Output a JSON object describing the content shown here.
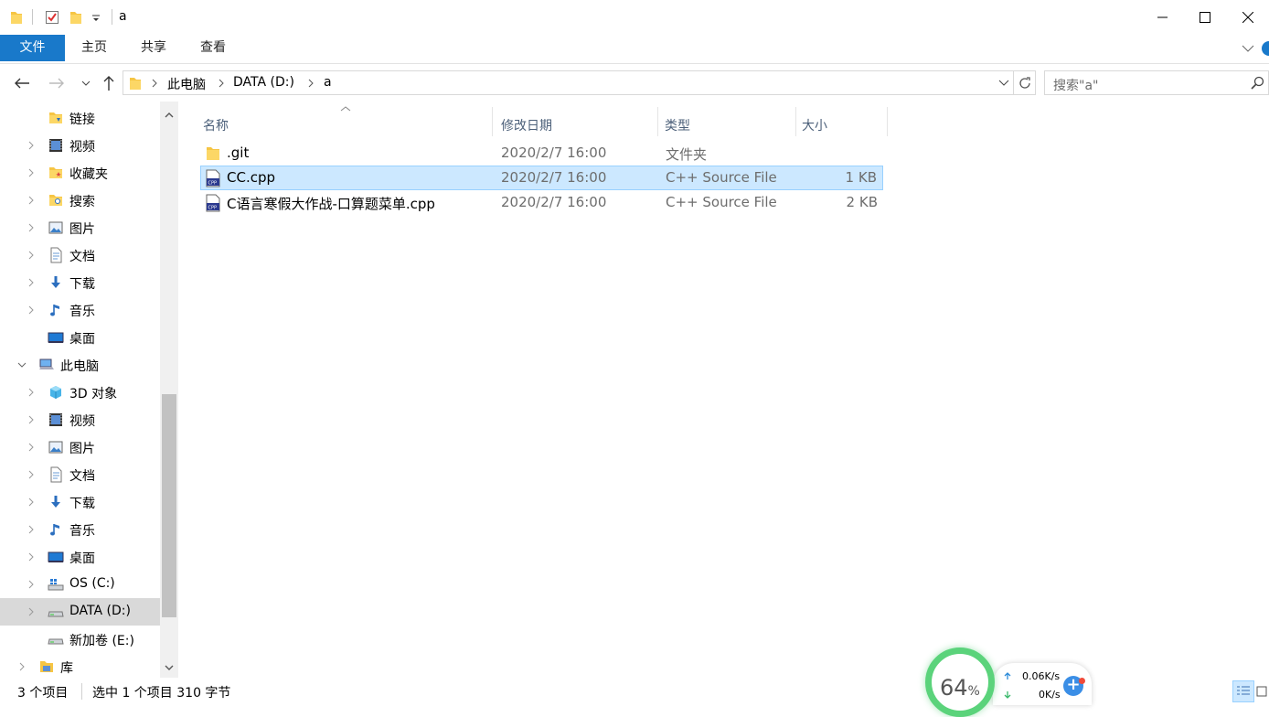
{
  "window": {
    "title": "a"
  },
  "ribbon": {
    "tabs": [
      "文件",
      "主页",
      "共享",
      "查看"
    ]
  },
  "address": {
    "breadcrumbs": [
      "此电脑",
      "DATA (D:)",
      "a"
    ],
    "search_placeholder": "搜索\"a\""
  },
  "sidebar": {
    "items": [
      {
        "label": "链接",
        "icon": "links-folder-icon"
      },
      {
        "label": "视频",
        "icon": "video-icon"
      },
      {
        "label": "收藏夹",
        "icon": "favorites-folder-icon"
      },
      {
        "label": "搜索",
        "icon": "search-folder-icon"
      },
      {
        "label": "图片",
        "icon": "pictures-icon"
      },
      {
        "label": "文档",
        "icon": "documents-icon"
      },
      {
        "label": "下载",
        "icon": "download-icon"
      },
      {
        "label": "音乐",
        "icon": "music-icon"
      },
      {
        "label": "桌面",
        "icon": "desktop-icon"
      },
      {
        "label": "此电脑",
        "icon": "this-pc-icon"
      },
      {
        "label": "3D 对象",
        "icon": "3d-objects-icon"
      },
      {
        "label": "视频",
        "icon": "video-icon"
      },
      {
        "label": "图片",
        "icon": "pictures-icon"
      },
      {
        "label": "文档",
        "icon": "documents-icon"
      },
      {
        "label": "下载",
        "icon": "download-icon"
      },
      {
        "label": "音乐",
        "icon": "music-icon"
      },
      {
        "label": "桌面",
        "icon": "desktop-icon"
      },
      {
        "label": "OS (C:)",
        "icon": "windows-drive-icon"
      },
      {
        "label": "DATA (D:)",
        "icon": "drive-icon"
      },
      {
        "label": "新加卷 (E:)",
        "icon": "drive-icon"
      },
      {
        "label": "库",
        "icon": "library-icon"
      }
    ]
  },
  "filelist": {
    "columns": {
      "name": "名称",
      "date": "修改日期",
      "type": "类型",
      "size": "大小"
    },
    "rows": [
      {
        "name": ".git",
        "date": "2020/2/7 16:00",
        "type": "文件夹",
        "size": ""
      },
      {
        "name": "CC.cpp",
        "date": "2020/2/7 16:00",
        "type": "C++ Source File",
        "size": "1 KB"
      },
      {
        "name": "C语言寒假大作战-口算题菜单.cpp",
        "date": "2020/2/7 16:00",
        "type": "C++ Source File",
        "size": "2 KB"
      }
    ]
  },
  "status": {
    "item_count": "3 个项目",
    "selection": "选中 1 个项目  310 字节"
  },
  "widget": {
    "percent": "64",
    "percent_unit": "%",
    "upload": "0.06K/s",
    "download": "0K/s"
  },
  "colors": {
    "accent": "#1979ca",
    "selection": "#cce8ff",
    "selection_border": "#99d1ff",
    "gauge": "#5bd37b"
  }
}
